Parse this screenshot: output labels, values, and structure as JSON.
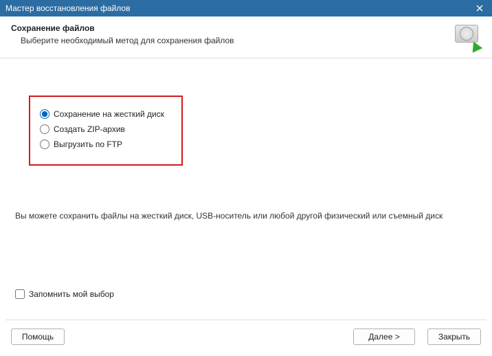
{
  "titlebar": {
    "title": "Мастер восстановления файлов"
  },
  "header": {
    "title": "Сохранение файлов",
    "subtitle": "Выберите необходимый метод для сохранения файлов"
  },
  "options": {
    "selected": 0,
    "items": [
      {
        "label": "Сохранение на жесткий диск"
      },
      {
        "label": "Создать ZIP-архив"
      },
      {
        "label": "Выгрузить по FTP"
      }
    ]
  },
  "description": "Вы можете сохранить файлы на жесткий диск, USB-носитель или любой другой физический или съемный диск",
  "remember": {
    "label": "Запомнить мой выбор",
    "checked": false
  },
  "buttons": {
    "help": "Помощь",
    "next": "Далее >",
    "close": "Закрыть"
  }
}
